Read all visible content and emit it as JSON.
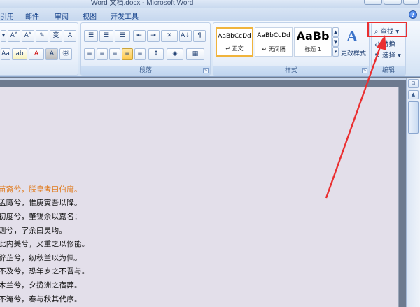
{
  "window": {
    "title": "Word 文档.docx - Microsoft Word"
  },
  "tabs": [
    {
      "label": "引用",
      "id": "references"
    },
    {
      "label": "邮件",
      "id": "mailings"
    },
    {
      "label": "审阅",
      "id": "review"
    },
    {
      "label": "视图",
      "id": "view"
    },
    {
      "label": "开发工具",
      "id": "developer"
    }
  ],
  "help_glyph": "?",
  "ribbon": {
    "font_group": {
      "grow_font": "A˄",
      "shrink_font": "A˅",
      "clear_format": "🧹",
      "phonetic": "变",
      "char_border": "A",
      "change_case": "Aa",
      "highlight": "ab",
      "font_color": "A",
      "char_shading": "A",
      "enclose_char": "㊥"
    },
    "paragraph_group": {
      "label": "段落",
      "bullets": "☰",
      "numbering": "☰",
      "multilevel": "☰",
      "dec_indent": "⇤",
      "inc_indent": "⇥",
      "chinese_layout": "✕",
      "sort": "A↓",
      "show_marks": "¶",
      "align_left": "≡",
      "center": "≡",
      "align_right": "≡",
      "justify": "≡",
      "distributed": "≡",
      "line_spacing": "↕",
      "shading": "◈",
      "borders": "▦"
    },
    "styles_group": {
      "label": "样式",
      "styles": [
        {
          "sample": "AaBbCcDd",
          "name": "↵ 正文",
          "selected": true
        },
        {
          "sample": "AaBbCcDd",
          "name": "↵ 无间隔",
          "selected": false
        },
        {
          "sample": "AaBb",
          "name": "标题 1",
          "selected": false
        }
      ],
      "change_styles": "更改样式"
    },
    "editing_group": {
      "label": "编辑",
      "find": "查找 ▾",
      "replace": "替换",
      "select": "选择 ▾"
    }
  },
  "document": {
    "lines": [
      {
        "text": "苗裔兮，朕皇考曰伯庸。",
        "style": "orange"
      },
      {
        "text": "孟陬兮，惟庚寅吾以降。",
        "style": "normal"
      },
      {
        "text": "初度兮，肇锡余以嘉名：",
        "style": "normal"
      },
      {
        "text": "则兮，字余曰灵均。",
        "style": "normal"
      },
      {
        "text": "此内美兮，又重之以修能。",
        "style": "normal"
      },
      {
        "text": "辟芷兮，纫秋兰以为佩。",
        "style": "normal"
      },
      {
        "text": "不及兮，恐年岁之不吾与。",
        "style": "normal"
      },
      {
        "text": "木兰兮，夕揽洲之宿莽。",
        "style": "normal"
      },
      {
        "text": "不淹兮，春与秋其代序。",
        "style": "normal"
      }
    ]
  },
  "scrollbar": {
    "up": "▲",
    "ruler_toggle": "⊟"
  },
  "colors": {
    "highlight_border": "#ea2f31",
    "arrow": "#ea2f31",
    "orange_text": "#e07b1e"
  }
}
